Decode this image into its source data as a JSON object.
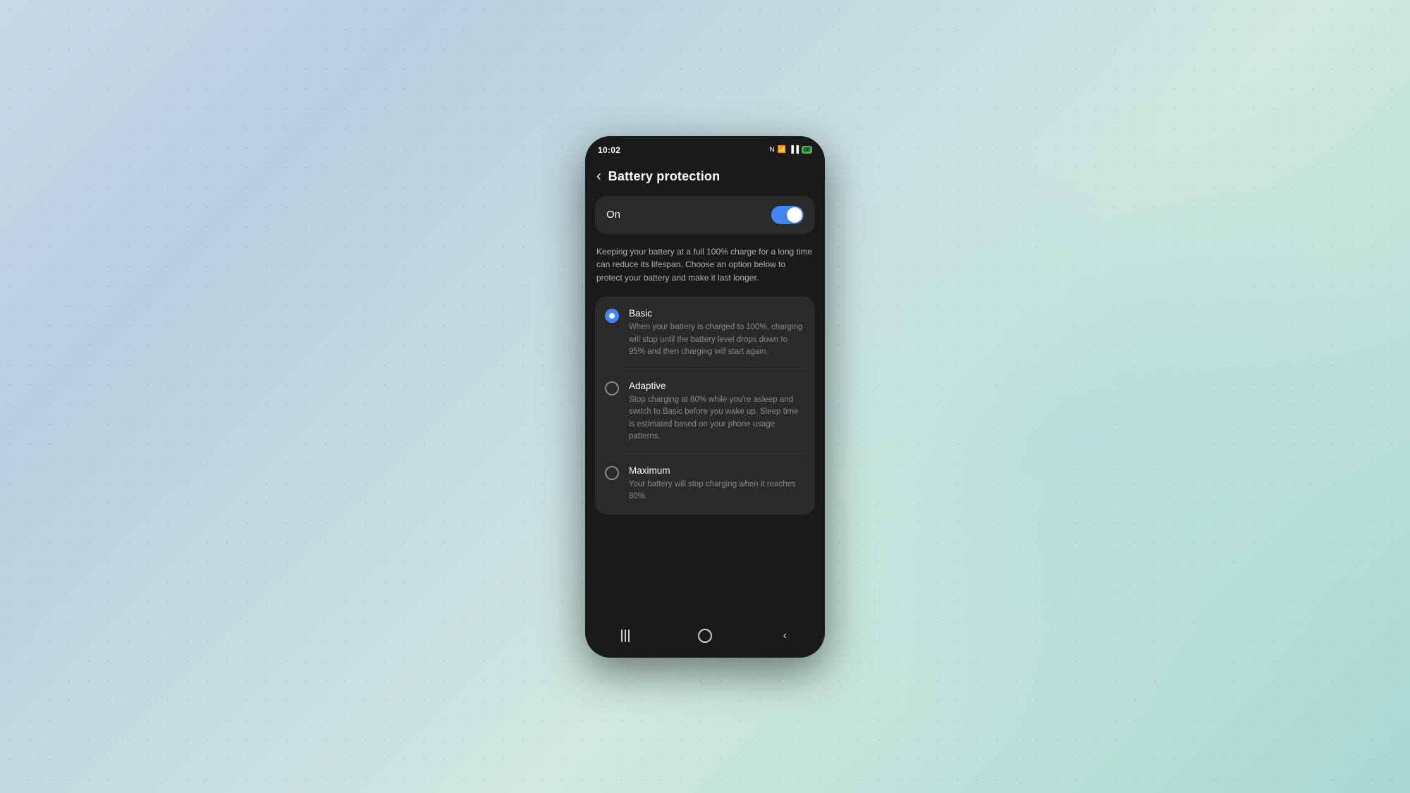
{
  "statusBar": {
    "time": "10:02",
    "batteryLevel": "88"
  },
  "header": {
    "title": "Battery protection",
    "backLabel": "‹"
  },
  "toggle": {
    "label": "On",
    "isOn": true
  },
  "description": "Keeping your battery at a full 100% charge for a long time can reduce its lifespan. Choose an option below to protect your battery and make it last longer.",
  "options": [
    {
      "id": "basic",
      "title": "Basic",
      "description": "When your battery is charged to 100%, charging will stop until the battery level drops down to 95% and then charging will start again.",
      "selected": true
    },
    {
      "id": "adaptive",
      "title": "Adaptive",
      "description": "Stop charging at 80% while you're asleep and switch to Basic before you wake up. Sleep time is estimated based on your phone usage patterns.",
      "selected": false
    },
    {
      "id": "maximum",
      "title": "Maximum",
      "description": "Your battery will stop charging when it reaches 80%.",
      "selected": false
    }
  ]
}
